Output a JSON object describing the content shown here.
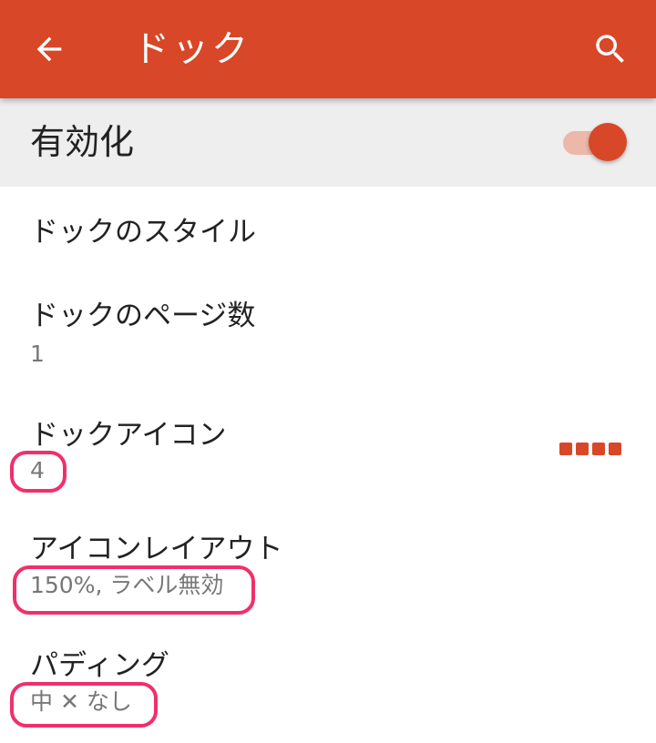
{
  "appbar": {
    "title": "ドック",
    "back_icon": "arrow-left-icon",
    "search_icon": "search-icon",
    "color": "#d84727"
  },
  "enable": {
    "label": "有効化",
    "switch_on": true
  },
  "preferences": [
    {
      "title": "ドックのスタイル",
      "summary": ""
    },
    {
      "title": "ドックのページ数",
      "summary": "1"
    },
    {
      "title": "ドックアイコン",
      "summary": "4"
    },
    {
      "title": "アイコンレイアウト",
      "summary": "150%, ラベル無効"
    },
    {
      "title": "パディング",
      "summary": "中 ✕ なし"
    }
  ],
  "dock_icon_preview": {
    "count": 4,
    "color": "#d84727"
  },
  "annotation_color": "#f0306a"
}
